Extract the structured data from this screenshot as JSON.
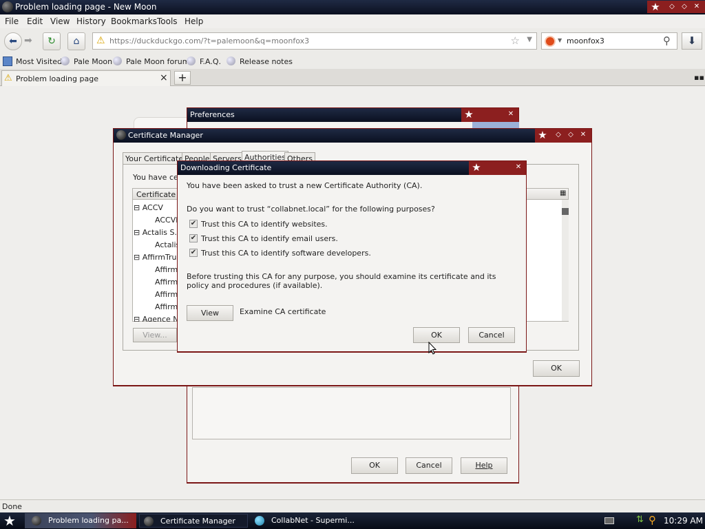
{
  "window": {
    "title": "Problem loading page - New Moon"
  },
  "menu": [
    "File",
    "Edit",
    "View",
    "History",
    "Bookmarks",
    "Tools",
    "Help"
  ],
  "nav": {
    "url": "https://duckduckgo.com/?t=palemoon&q=moonfox3",
    "search_value": "moonfox3"
  },
  "bookmarks": [
    "Most Visited",
    "Pale Moon",
    "Pale Moon forum",
    "F.A.Q.",
    "Release notes"
  ],
  "tab": {
    "label": "Problem loading page",
    "close": "×",
    "new": "+"
  },
  "preferences": {
    "title": "Preferences",
    "ok": "OK",
    "cancel": "Cancel",
    "help": "Help"
  },
  "cert_manager": {
    "title": "Certificate Manager",
    "tabs": [
      "Your Certificates",
      "People",
      "Servers",
      "Authorities",
      "Others"
    ],
    "intro": "You have cert",
    "column": "Certificate N",
    "tree": [
      {
        "label": "ACCV",
        "level": 0
      },
      {
        "label": "ACCVR",
        "level": 1
      },
      {
        "label": "Actalis S.p",
        "level": 0
      },
      {
        "label": "Actalis",
        "level": 1
      },
      {
        "label": "AffirmTrust",
        "level": 0
      },
      {
        "label": "AffirmT",
        "level": 1
      },
      {
        "label": "AffirmT",
        "level": 1
      },
      {
        "label": "AffirmT",
        "level": 1
      },
      {
        "label": "AffirmT",
        "level": 1
      },
      {
        "label": "Agence Na",
        "level": 0
      }
    ],
    "view": "View...",
    "ok": "OK"
  },
  "download_cert": {
    "title": "Downloading Certificate",
    "line1": "You have been asked to trust a new Certificate Authority (CA).",
    "line2": "Do you want to trust “collabnet.local” for the following purposes?",
    "checks": [
      {
        "label": "Trust this CA to identify websites.",
        "checked": true
      },
      {
        "label": "Trust this CA to identify email users.",
        "checked": true
      },
      {
        "label": "Trust this CA to identify software developers.",
        "checked": true
      }
    ],
    "before": "Before trusting this CA for any purpose, you should examine its certificate and its policy and procedures (if available).",
    "view": "View",
    "examine": "Examine CA certificate",
    "ok": "OK",
    "cancel": "Cancel"
  },
  "status": "Done",
  "taskbar": {
    "items": [
      "Problem loading pa...",
      "Certificate Manager",
      "CollabNet - Supermi..."
    ],
    "clock": "10:29 AM"
  }
}
